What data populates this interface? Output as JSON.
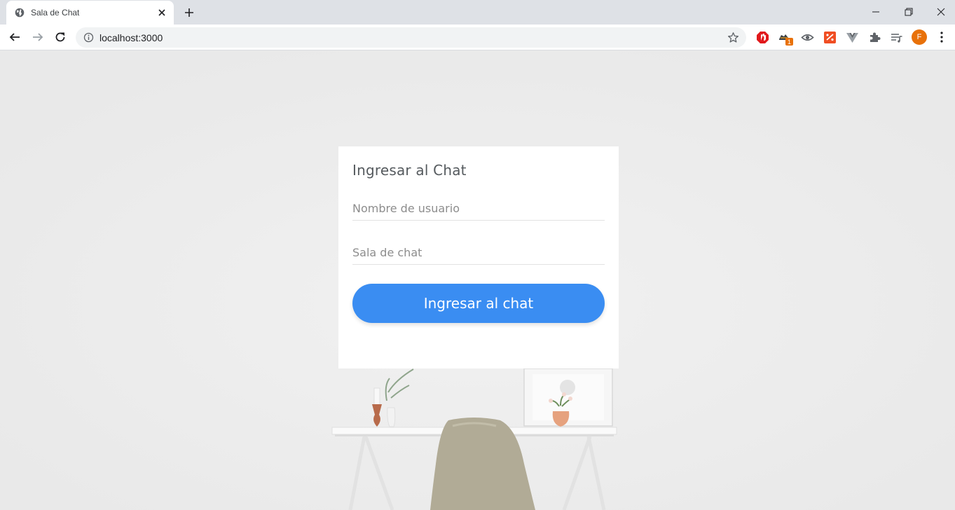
{
  "browser": {
    "tab_title": "Sala de Chat",
    "url": "localhost:3000",
    "profile_initial": "F",
    "extension_badge": "1",
    "icons": [
      "globe-icon",
      "close-icon",
      "plus-icon",
      "minimize-icon",
      "restore-icon",
      "close-window-icon",
      "back-arrow-icon",
      "forward-arrow-icon",
      "reload-icon",
      "info-icon",
      "star-icon",
      "extensions-puzzle-icon",
      "media-queue-icon",
      "kebab-menu-icon"
    ]
  },
  "login": {
    "title": "Ingresar al Chat",
    "username_placeholder": "Nombre de usuario",
    "room_placeholder": "Sala de chat",
    "submit_label": "Ingresar al chat"
  },
  "colors": {
    "button": "#3a8df2",
    "page_background": "#ededed",
    "avatar": "#e8710a"
  }
}
